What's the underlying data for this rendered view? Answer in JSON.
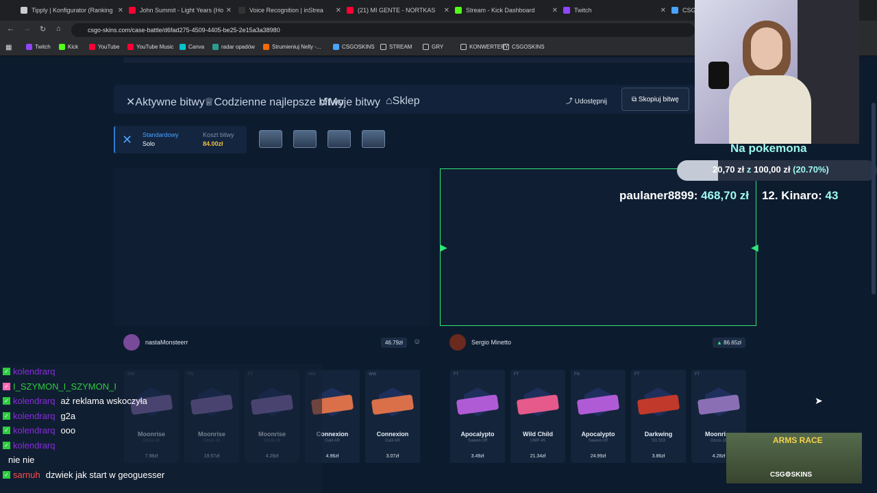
{
  "browser": {
    "tabs": [
      {
        "label": "Tipply | Konfigurator (Ranking",
        "color": "#cccccc"
      },
      {
        "label": "John Summit - Light Years (Ho",
        "color": "#ff0033"
      },
      {
        "label": "Voice Recognition | inStrea",
        "color": "#333333"
      },
      {
        "label": "(21) MI GENTE - NORTKAS",
        "color": "#ff0033"
      },
      {
        "label": "Stream - Kick Dashboard",
        "color": "#53fc18"
      },
      {
        "label": "Twitch",
        "color": "#9146ff"
      },
      {
        "label": "CSG",
        "color": "#4aa3ff"
      }
    ],
    "url": "csgo-skins.com/case-battle/d6fad275-4509-4405-be25-2e15a3a38980",
    "bookmarks": [
      {
        "label": "Twitch",
        "color": "#9146ff"
      },
      {
        "label": "Kick",
        "color": "#53fc18"
      },
      {
        "label": "YouTube",
        "color": "#ff0033"
      },
      {
        "label": "YouTube Music",
        "color": "#ff0033"
      },
      {
        "label": "Canva",
        "color": "#00c4cc"
      },
      {
        "label": "radar opadów",
        "color": "#2a9d8f"
      },
      {
        "label": "Strumieniuj Nelly -...",
        "color": "#ff6a00"
      },
      {
        "label": "CSGOSKINS",
        "color": "#4aa3ff"
      },
      {
        "label": "STREAM",
        "color": "folder"
      },
      {
        "label": "GRY",
        "color": "folder"
      },
      {
        "label": "KONWERTERY",
        "color": "folder"
      },
      {
        "label": "CSGOSKINS",
        "color": "folder"
      }
    ]
  },
  "site": {
    "nav": [
      {
        "label": "Aktywne bitwy",
        "icon": "swords-icon"
      },
      {
        "label": "Codzienne najlepsze bitwy",
        "icon": "trophy-icon"
      },
      {
        "label": "Moje bitwy",
        "icon": "history-icon"
      },
      {
        "label": "Sklep",
        "icon": "shop-icon"
      }
    ],
    "share": "Udostępnij",
    "copy": "Skopiuj bitwę",
    "mode": {
      "type": "Standardowy",
      "sub": "Solo",
      "cost_label": "Koszt bitwy",
      "cost": "84.00zł"
    },
    "players": [
      {
        "name": "nastaMonsteerr",
        "value": "46.79zł",
        "color": "#7a4a9a"
      },
      {
        "name": "Sergio Minetto",
        "value": "86.65zł",
        "color": "#6b2a1e"
      }
    ],
    "items_left": [
      {
        "cond": "MW",
        "name": "Moonrise",
        "skin": "Glock-18",
        "price": "7.98zł",
        "gun": "#8b6fb5"
      },
      {
        "cond": "FN",
        "name": "Moonrise",
        "skin": "Glock-18",
        "price": "19.57zł",
        "gun": "#8b6fb5"
      },
      {
        "cond": "FT",
        "name": "Moonrise",
        "skin": "Glock-18",
        "price": "4.28zł",
        "gun": "#8b6fb5"
      },
      {
        "cond": "MW",
        "name": "Connexion",
        "skin": "Galil AR",
        "price": "4.96zł",
        "gun": "#d9704a"
      },
      {
        "cond": "WW",
        "name": "Connexion",
        "skin": "Galil AR",
        "price": "3.07zł",
        "gun": "#d9704a"
      }
    ],
    "items_right": [
      {
        "cond": "FT",
        "name": "Apocalypto",
        "skin": "Sawed-Off",
        "price": "3.49zł",
        "gun": "#b05bd6"
      },
      {
        "cond": "FT",
        "name": "Wild Child",
        "skin": "UMP-45",
        "price": "21.34zł",
        "gun": "#e55a8a"
      },
      {
        "cond": "FN",
        "name": "Apocalypto",
        "skin": "Sawed-Off",
        "price": "24.99zł",
        "gun": "#b05bd6"
      },
      {
        "cond": "FT",
        "name": "Darkwing",
        "skin": "SG 553",
        "price": "3.86zł",
        "gun": "#c0392b"
      },
      {
        "cond": "FT",
        "name": "Moonrise",
        "skin": "Glock-18",
        "price": "4.28zł",
        "gun": "#8b6fb5"
      }
    ]
  },
  "overlay": {
    "goal_title": "Na pokemona",
    "goal_text_current": "20,70 zł",
    "goal_text_mid": " z ",
    "goal_text_target": "100,00 zł",
    "goal_text_pct": "(20.70%)",
    "goal_fraction": 0.207,
    "ticker_name1": "paulaner8899",
    "ticker_amount1": "468,70 zł",
    "ticker_name2": "12. Kinaro",
    "ticker_amount2": "43",
    "ad_title": "ARMS RACE",
    "ad_brand": "CSG⚙SKINS"
  },
  "chat": [
    {
      "user": "kolendrarq",
      "msg": "",
      "ucolor": "#8a2be2",
      "badge": "#2ecc40"
    },
    {
      "user": "I_SZYMON_I_SZYMON_I",
      "msg": "",
      "ucolor": "#2ecc40",
      "badge": "#ff69b4"
    },
    {
      "user": "kolendrarq",
      "msg": "aż reklama wskoczyła",
      "ucolor": "#8a2be2",
      "badge": "#2ecc40"
    },
    {
      "user": "kolendrarq",
      "msg": "g2a",
      "ucolor": "#8a2be2",
      "badge": "#2ecc40"
    },
    {
      "user": "kolendrarq",
      "msg": "ooo",
      "ucolor": "#8a2be2",
      "badge": "#2ecc40"
    },
    {
      "user": "kolendrarq",
      "msg": "",
      "ucolor": "#8a2be2",
      "badge": "#2ecc40"
    },
    {
      "user": "",
      "msg": "nie nie",
      "ucolor": "#6a5acd",
      "badge": ""
    },
    {
      "user": "sarnuh",
      "msg": "dzwiek jak start w geoguesser",
      "ucolor": "#ff4f4f",
      "badge": "#2ecc40"
    }
  ]
}
